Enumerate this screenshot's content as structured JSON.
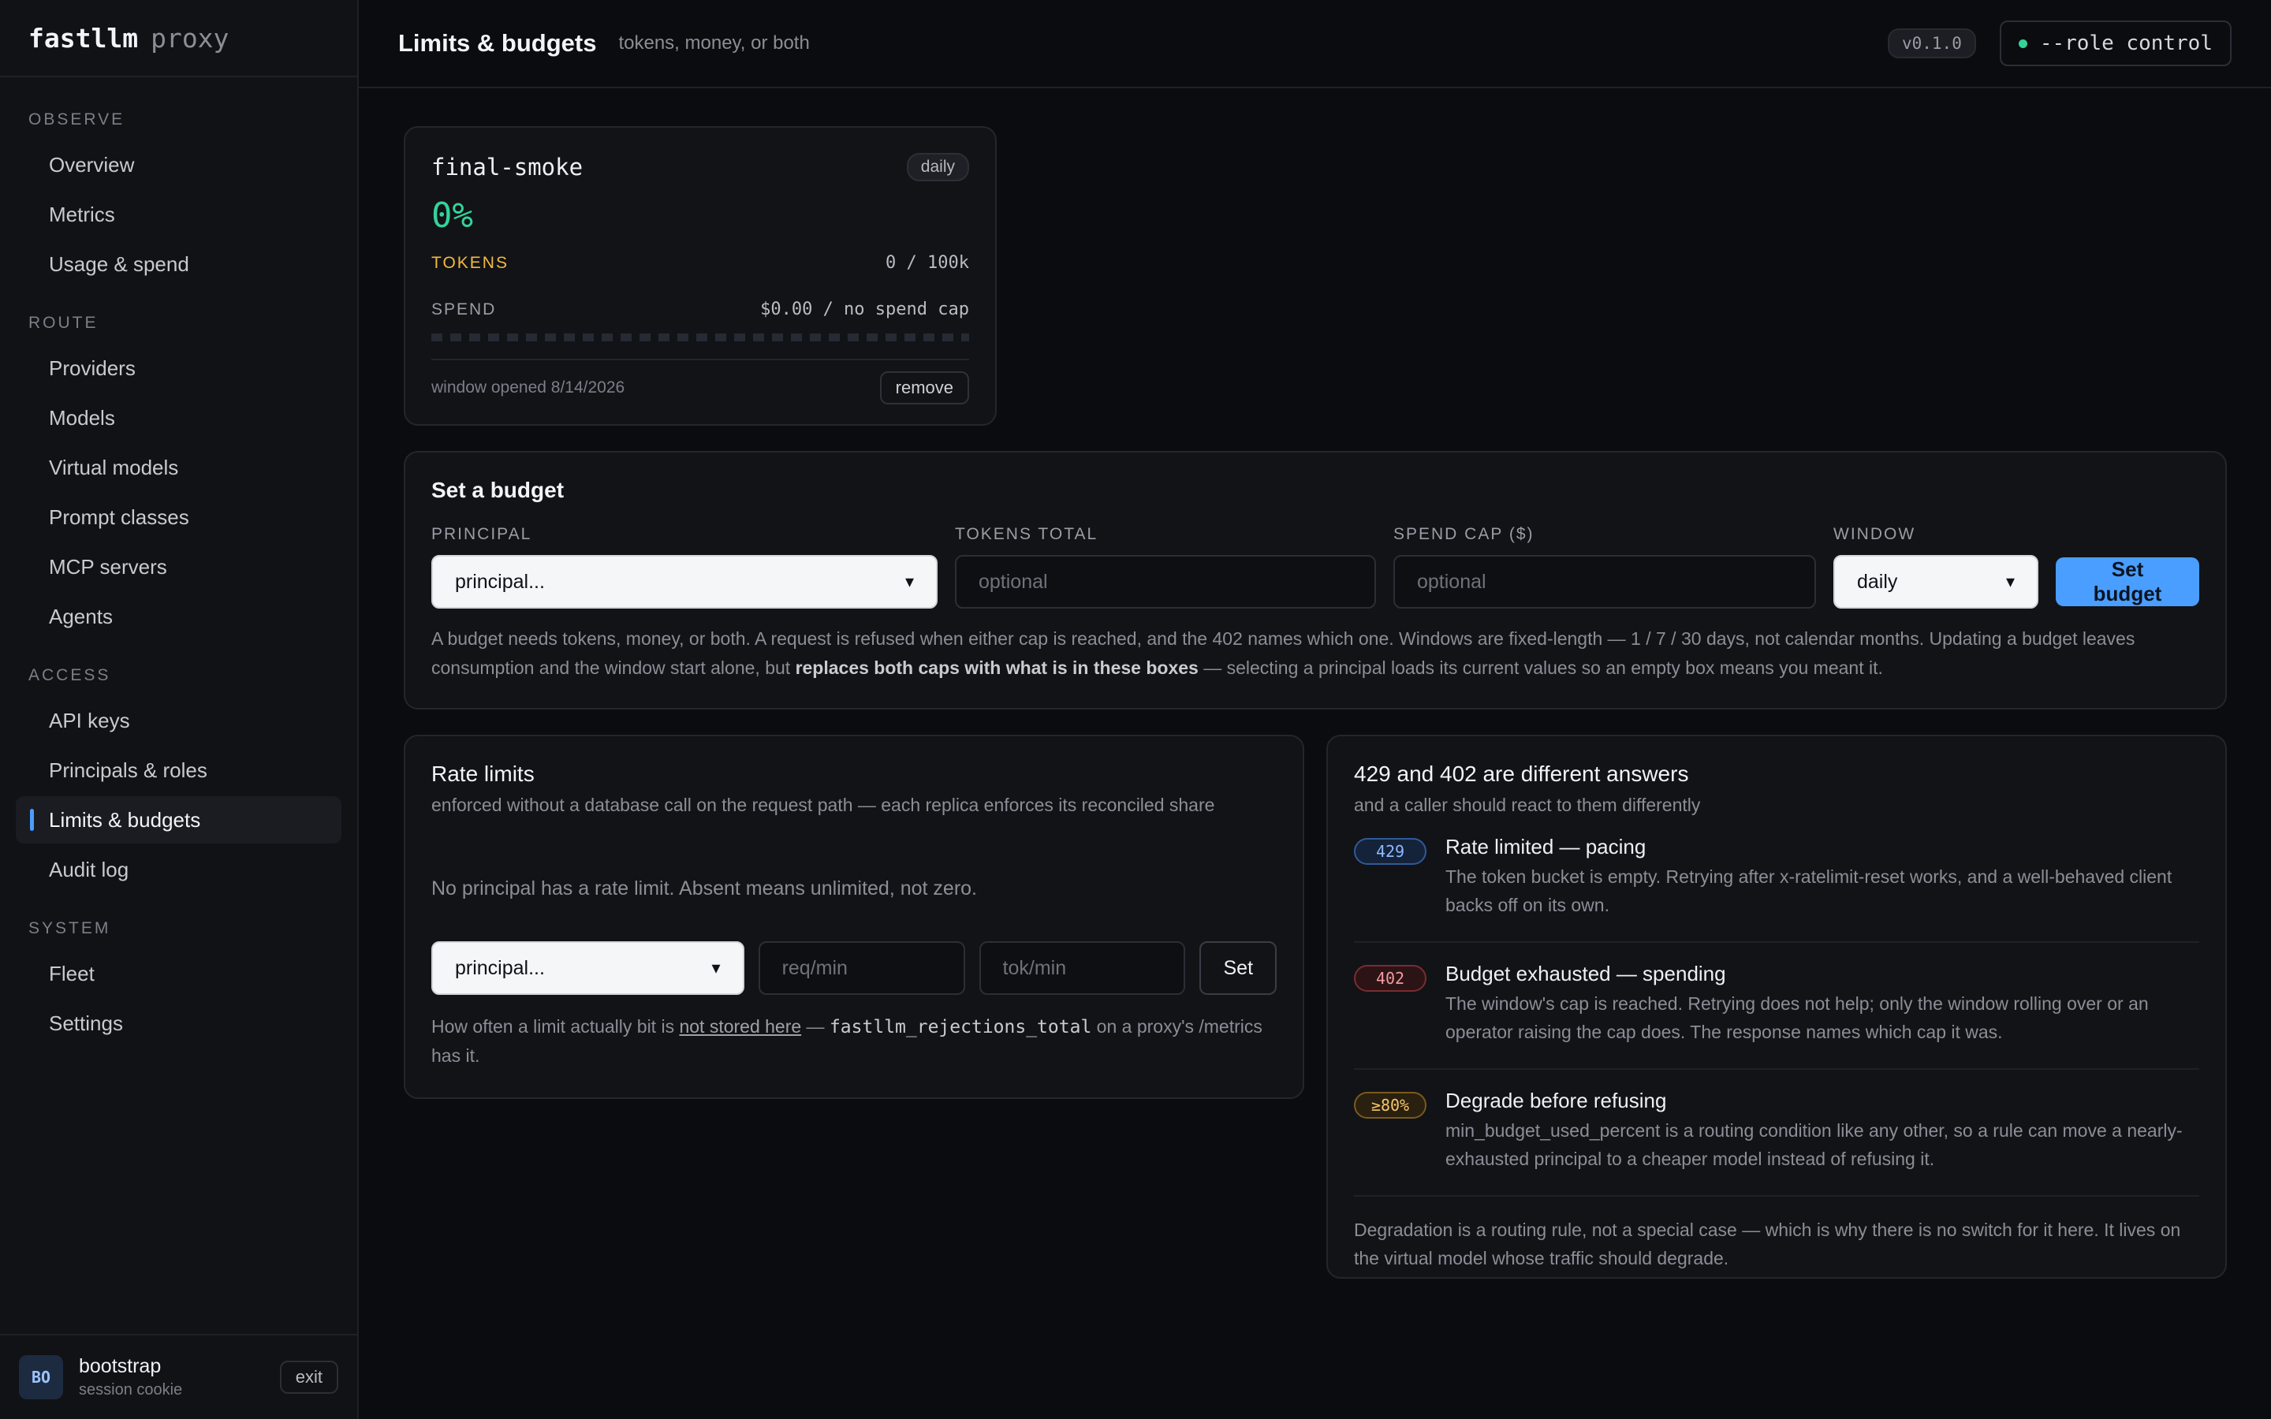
{
  "brand": {
    "name": "fastllm",
    "suffix": "proxy"
  },
  "sidebar": {
    "sections": [
      {
        "label": "OBSERVE",
        "items": [
          "Overview",
          "Metrics",
          "Usage & spend"
        ]
      },
      {
        "label": "ROUTE",
        "items": [
          "Providers",
          "Models",
          "Virtual models",
          "Prompt classes",
          "MCP servers",
          "Agents"
        ]
      },
      {
        "label": "ACCESS",
        "items": [
          "API keys",
          "Principals & roles",
          "Limits & budgets",
          "Audit log"
        ]
      },
      {
        "label": "SYSTEM",
        "items": [
          "Fleet",
          "Settings"
        ]
      }
    ],
    "active": "Limits & budgets"
  },
  "user": {
    "initials": "BO",
    "name": "bootstrap",
    "sub": "session cookie",
    "exit_label": "exit"
  },
  "header": {
    "title": "Limits & budgets",
    "subtitle": "tokens, money, or both",
    "version": "v0.1.0",
    "role": "--role control"
  },
  "budget_card": {
    "name": "final-smoke",
    "window": "daily",
    "percent": "0%",
    "tokens_label": "TOKENS",
    "tokens_value": "0 / 100k",
    "spend_label": "SPEND",
    "spend_value": "$0.00 / no spend cap",
    "opened": "window opened 8/14/2026",
    "remove_label": "remove"
  },
  "set_budget": {
    "title": "Set a budget",
    "principal_label": "PRINCIPAL",
    "principal_value": "principal...",
    "tokens_label": "TOKENS TOTAL",
    "tokens_placeholder": "optional",
    "spend_label": "SPEND CAP ($)",
    "spend_placeholder": "optional",
    "window_label": "WINDOW",
    "window_value": "daily",
    "submit_label": "Set budget",
    "note_a": "A budget needs tokens, money, or both. A request is refused when either cap is reached, and the 402 names which one. Windows are fixed-length — 1 / 7 / 30 days, not calendar months. Updating a budget leaves consumption and the window start alone, but ",
    "note_bold": "replaces both caps with what is in these boxes",
    "note_b": " — selecting a principal loads its current values so an empty box means you meant it."
  },
  "rate_limits": {
    "title": "Rate limits",
    "subtitle": "enforced without a database call on the request path — each replica enforces its reconciled share",
    "empty": "No principal has a rate limit. Absent means unlimited, not zero.",
    "principal_value": "principal...",
    "req_placeholder": "req/min",
    "tok_placeholder": "tok/min",
    "set_label": "Set",
    "note_a": "How often a limit actually bit is ",
    "note_link": "not stored here",
    "note_b": " — ",
    "note_code": "fastllm_rejections_total",
    "note_c": " on a proxy's /metrics has it."
  },
  "answers": {
    "title": "429 and 402 are different answers",
    "subtitle": "and a caller should react to them differently",
    "items": [
      {
        "badge": "429",
        "title": "Rate limited — pacing",
        "text": "The token bucket is empty. Retrying after x-ratelimit-reset works, and a well-behaved client backs off on its own."
      },
      {
        "badge": "402",
        "title": "Budget exhausted — spending",
        "text": "The window's cap is reached. Retrying does not help; only the window rolling over or an operator raising the cap does. The response names which cap it was."
      },
      {
        "badge": "≥80%",
        "title": "Degrade before refusing",
        "text": "min_budget_used_percent is a routing condition like any other, so a rule can move a nearly-exhausted principal to a cheaper model instead of refusing it."
      }
    ],
    "footer": "Degradation is a routing rule, not a special case — which is why there is no switch for it here. It lives on the virtual model whose traffic should degrade."
  },
  "colors": {
    "accent": "#4a9eff",
    "ok": "#34d399",
    "tokens": "#f5b942",
    "danger": "#f87171"
  }
}
